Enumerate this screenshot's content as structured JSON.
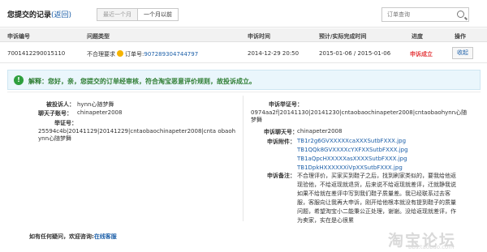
{
  "header": {
    "title": "您提交的记录",
    "back_link": "(返回)",
    "tabs": [
      "最近一个月",
      "一个月以前"
    ],
    "search_placeholder": "订单查询"
  },
  "table": {
    "columns": [
      "申诉编号",
      "问题类型",
      "申诉时间",
      "预计/实际完成时间",
      "进度",
      "操作"
    ],
    "row": {
      "id": "7001412290015110",
      "type": "不合理要求",
      "order_label": "订单号:",
      "order_no": "907289304744797",
      "time": "2014-12-29 20:50",
      "completion": "2015-01-06 / 2015-01-06",
      "status": "申诉成立",
      "action": "收起"
    }
  },
  "notice": {
    "icon_glyph": "!",
    "text": "解释：您好，亲，您提交的订单经审核，符合淘宝恶意评价规则，故投诉成立。"
  },
  "detail": {
    "respondent_label": "被投诉人：",
    "respondent": "hynn心随梦舞",
    "chat_label": "聊天子账号：",
    "chat_account": "chinapeter2008",
    "evidence_label": "举证号：",
    "evidence_no": "25594c4b|20141129|20141229|cntaobaochinapeter2008|cnta obaohynn心随梦舞",
    "appeal_evidence_label": "申诉举证号：",
    "appeal_evidence_no": "0974aa2f|20141130|20141230|cntaobaochinapeter2008|cntaobaohynn心随梦舞",
    "appeal_chat_label": "申诉聊天号：",
    "appeal_chat": "chinapeter2008",
    "attachments_label": "申诉附件：",
    "attachments": [
      "TB1r2g6GVXXXXXcaXXXSutbFXXX.jpg",
      "TB1QQk8GVXXXXcYXFXXSutbFXXX.jpg",
      "TB1aQpcHXXXXXasXXXXSutbFXXX.jpg",
      "TB1DpkHXXXXXXiVpXXSutbFXXX.jpg"
    ],
    "remark_label": "申诉备注：",
    "remark": "不合理评价，买家买到鞋子之后，找到刷家类似的，要我给他返现验他，不给返现就退货，后来说不给返现就差评，迁就静我说如果不给就在差评中写到我们鞋子质量差。我已经联系过去客服，客服向让我再大申诉，刚开给他根本就没有提到鞋子的质量问题，希望淘宝小二能秉公正处理，谢谢。没给返现就差评，作为卖家，实在是心很累"
  },
  "footer": {
    "question": "如有任何疑问，欢迎咨询:",
    "service_link": "在线客服"
  },
  "watermark": {
    "main": "淘宝论坛",
    "sub": "bbs.taobao.com"
  }
}
